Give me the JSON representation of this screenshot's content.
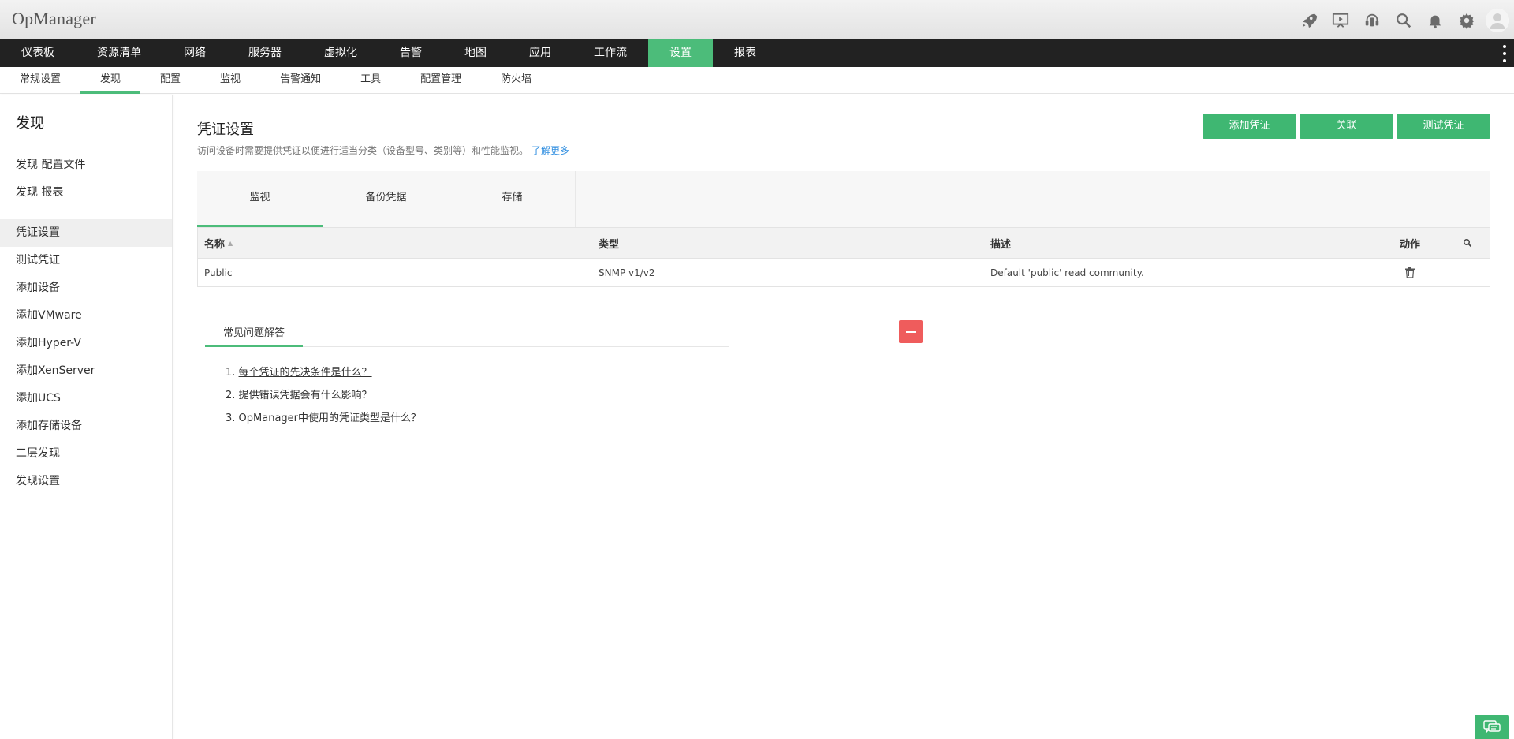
{
  "app": {
    "title": "OpManager"
  },
  "header": {
    "icons": [
      "rocket-icon",
      "presentation-icon",
      "support-icon",
      "search-icon",
      "bell-icon",
      "gear-icon",
      "user-avatar-icon"
    ]
  },
  "mainnav": {
    "items": [
      {
        "label": "仪表板"
      },
      {
        "label": "资源清单"
      },
      {
        "label": "网络"
      },
      {
        "label": "服务器"
      },
      {
        "label": "虚拟化"
      },
      {
        "label": "告警"
      },
      {
        "label": "地图"
      },
      {
        "label": "应用"
      },
      {
        "label": "工作流"
      },
      {
        "label": "设置",
        "active": true
      },
      {
        "label": "报表"
      }
    ]
  },
  "subnav": {
    "items": [
      {
        "label": "常规设置"
      },
      {
        "label": "发现",
        "active": true
      },
      {
        "label": "配置"
      },
      {
        "label": "监视"
      },
      {
        "label": "告警通知"
      },
      {
        "label": "工具"
      },
      {
        "label": "配置管理"
      },
      {
        "label": "防火墙"
      }
    ]
  },
  "sidebar": {
    "title": "发现",
    "items": [
      {
        "label": "发现 配置文件"
      },
      {
        "label": "发现 报表"
      },
      {
        "label": "凭证设置",
        "active": true
      },
      {
        "label": "测试凭证"
      },
      {
        "label": "添加设备"
      },
      {
        "label": "添加VMware"
      },
      {
        "label": "添加Hyper-V"
      },
      {
        "label": "添加XenServer"
      },
      {
        "label": "添加UCS"
      },
      {
        "label": "添加存储设备"
      },
      {
        "label": "二层发现"
      },
      {
        "label": "发现设置"
      }
    ]
  },
  "main": {
    "title": "凭证设置",
    "description": "访问设备时需要提供凭证以便进行适当分类（设备型号、类别等）和性能监视。",
    "learn_more": "了解更多",
    "buttons": {
      "add": "添加凭证",
      "associate": "关联",
      "test": "测试凭证"
    },
    "tabs": [
      {
        "label": "监视",
        "active": true
      },
      {
        "label": "备份凭据"
      },
      {
        "label": "存储"
      }
    ],
    "table": {
      "headers": {
        "name": "名称",
        "type": "类型",
        "description": "描述",
        "action": "动作"
      },
      "rows": [
        {
          "name": "Public",
          "type": "SNMP v1/v2",
          "description": "Default 'public' read community."
        }
      ]
    },
    "faq": {
      "title": "常见问题解答",
      "items": [
        "每个凭证的先决条件是什么？",
        "提供错误凭据会有什么影响？",
        "OpManager中使用的凭证类型是什么？"
      ],
      "numbers": [
        "1.",
        "2.",
        "3."
      ]
    }
  },
  "colors": {
    "accent": "#4cbc7a",
    "button": "#3fb772",
    "collapse": "#ef5c5c",
    "nav_bg": "#222222",
    "link": "#2f8ee0"
  }
}
